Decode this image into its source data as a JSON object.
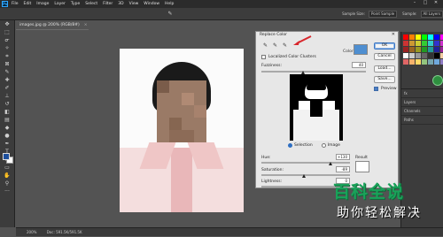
{
  "app": {
    "logo": "Ps",
    "menu": [
      "File",
      "Edit",
      "Image",
      "Layer",
      "Type",
      "Select",
      "Filter",
      "3D",
      "View",
      "Window",
      "Help"
    ],
    "window_controls": [
      "–",
      "□",
      "✕"
    ]
  },
  "options_bar": {
    "sample_size_label": "Sample Size:",
    "sample_size_value": "Point Sample",
    "sample_label": "Sample:",
    "sample_value": "All Layers"
  },
  "document": {
    "tab_label": "images.jpg @ 200% (RGB/8#)",
    "close_glyph": "×"
  },
  "status": {
    "zoom": "200%",
    "doc_info": "Doc: 591.5K/591.5K"
  },
  "colors": {
    "foreground": "#1d4f9c",
    "background": "#ffffff",
    "selected_color": "#4f8fd1",
    "result_color": "#ffffff"
  },
  "dialog": {
    "title": "Replace Color",
    "close_glyph": "✕",
    "color_label": "Color:",
    "localized_label": "Localized Color Clusters",
    "fuzziness_label": "Fuzziness:",
    "fuzziness_value": "40",
    "fuzziness_level_pct": 40,
    "selection_label": "Selection",
    "image_label": "Image",
    "replacement": {
      "hue_label": "Hue:",
      "hue_value": "+130",
      "saturation_label": "Saturation:",
      "saturation_value": "-89",
      "lightness_label": "Lightness:",
      "lightness_value": "0",
      "result_label": "Result"
    },
    "buttons": {
      "ok": "OK",
      "cancel": "Cancel",
      "load": "Load...",
      "save": "Save..."
    },
    "preview_label": "Preview"
  },
  "panels": {
    "rows": [
      "fx",
      "Layers",
      "Channels",
      "Paths"
    ]
  },
  "watermark": {
    "line1": "百科全说",
    "line2": "助你轻松解决"
  }
}
